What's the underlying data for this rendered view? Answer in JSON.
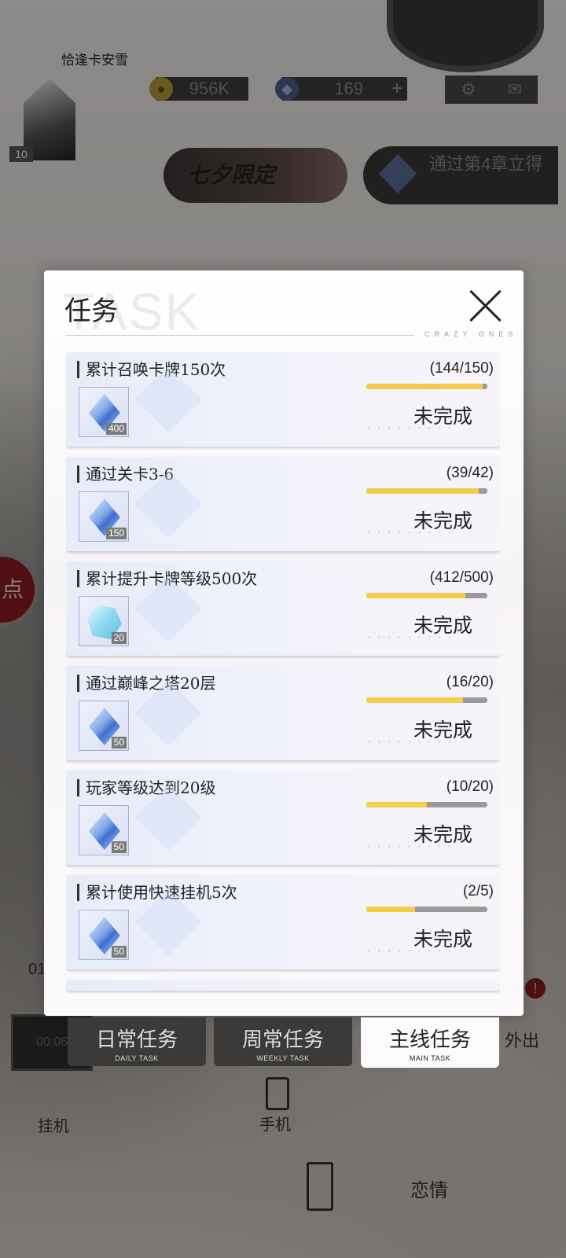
{
  "header": {
    "player_name": "恰逢卡安雪",
    "level": "10",
    "coins": "956K",
    "gems": "169",
    "gem_plus": "+"
  },
  "banners": {
    "event_text": "七夕限定",
    "chapter_text": "通过第4章立得"
  },
  "background": {
    "side_label": "点",
    "time": "01",
    "pc_time": "00:06",
    "go_out_label": "外出",
    "idle_label": "挂机",
    "phone_label": "手机",
    "romance_label": "恋情",
    "badge": "!"
  },
  "modal": {
    "title": "任务",
    "watermark": "TASK",
    "tagline": "CRAZY ONES"
  },
  "tasks": [
    {
      "name": "累计召唤卡牌150次",
      "progress": "(144/150)",
      "fill": 0.96,
      "reward_type": "gem",
      "reward_count": "400",
      "status": "未完成"
    },
    {
      "name": "通过关卡3-6",
      "progress": "(39/42)",
      "fill": 0.93,
      "reward_type": "gem",
      "reward_count": "150",
      "status": "未完成"
    },
    {
      "name": "累计提升卡牌等级500次",
      "progress": "(412/500)",
      "fill": 0.82,
      "reward_type": "crystal",
      "reward_count": "20",
      "status": "未完成"
    },
    {
      "name": "通过巅峰之塔20层",
      "progress": "(16/20)",
      "fill": 0.8,
      "reward_type": "gem",
      "reward_count": "50",
      "status": "未完成"
    },
    {
      "name": "玩家等级达到20级",
      "progress": "(10/20)",
      "fill": 0.5,
      "reward_type": "gem",
      "reward_count": "50",
      "status": "未完成"
    },
    {
      "name": "累计使用快速挂机5次",
      "progress": "(2/5)",
      "fill": 0.4,
      "reward_type": "gem",
      "reward_count": "50",
      "status": "未完成"
    }
  ],
  "tabs": [
    {
      "cn": "日常任务",
      "en": "DAILY TASK",
      "active": false
    },
    {
      "cn": "周常任务",
      "en": "WEEKLY TASK",
      "active": false
    },
    {
      "cn": "主线任务",
      "en": "MAIN TASK",
      "active": true
    }
  ]
}
